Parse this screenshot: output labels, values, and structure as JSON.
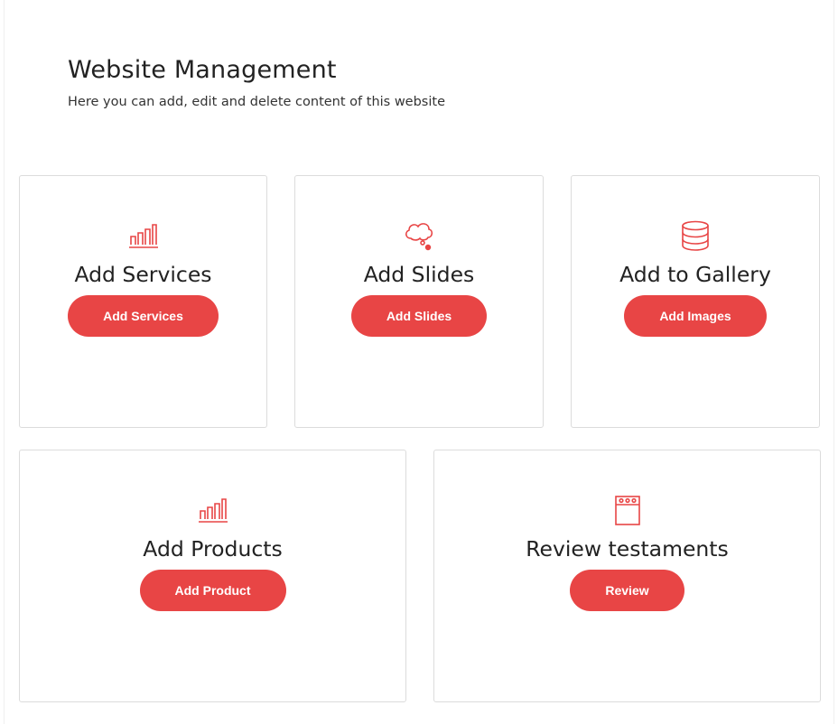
{
  "header": {
    "title": "Website Management",
    "subtitle": "Here you can add, edit and delete content of this website"
  },
  "accent_color": "#e84545",
  "cards": [
    {
      "icon": "bar-chart-icon",
      "title": "Add Services",
      "button_label": "Add Services"
    },
    {
      "icon": "thought-cloud-icon",
      "title": "Add Slides",
      "button_label": "Add Slides"
    },
    {
      "icon": "database-icon",
      "title": "Add to Gallery",
      "button_label": "Add Images"
    },
    {
      "icon": "bar-chart-icon",
      "title": "Add Products",
      "button_label": "Add Product"
    },
    {
      "icon": "notepad-icon",
      "title": "Review testaments",
      "button_label": "Review"
    }
  ]
}
